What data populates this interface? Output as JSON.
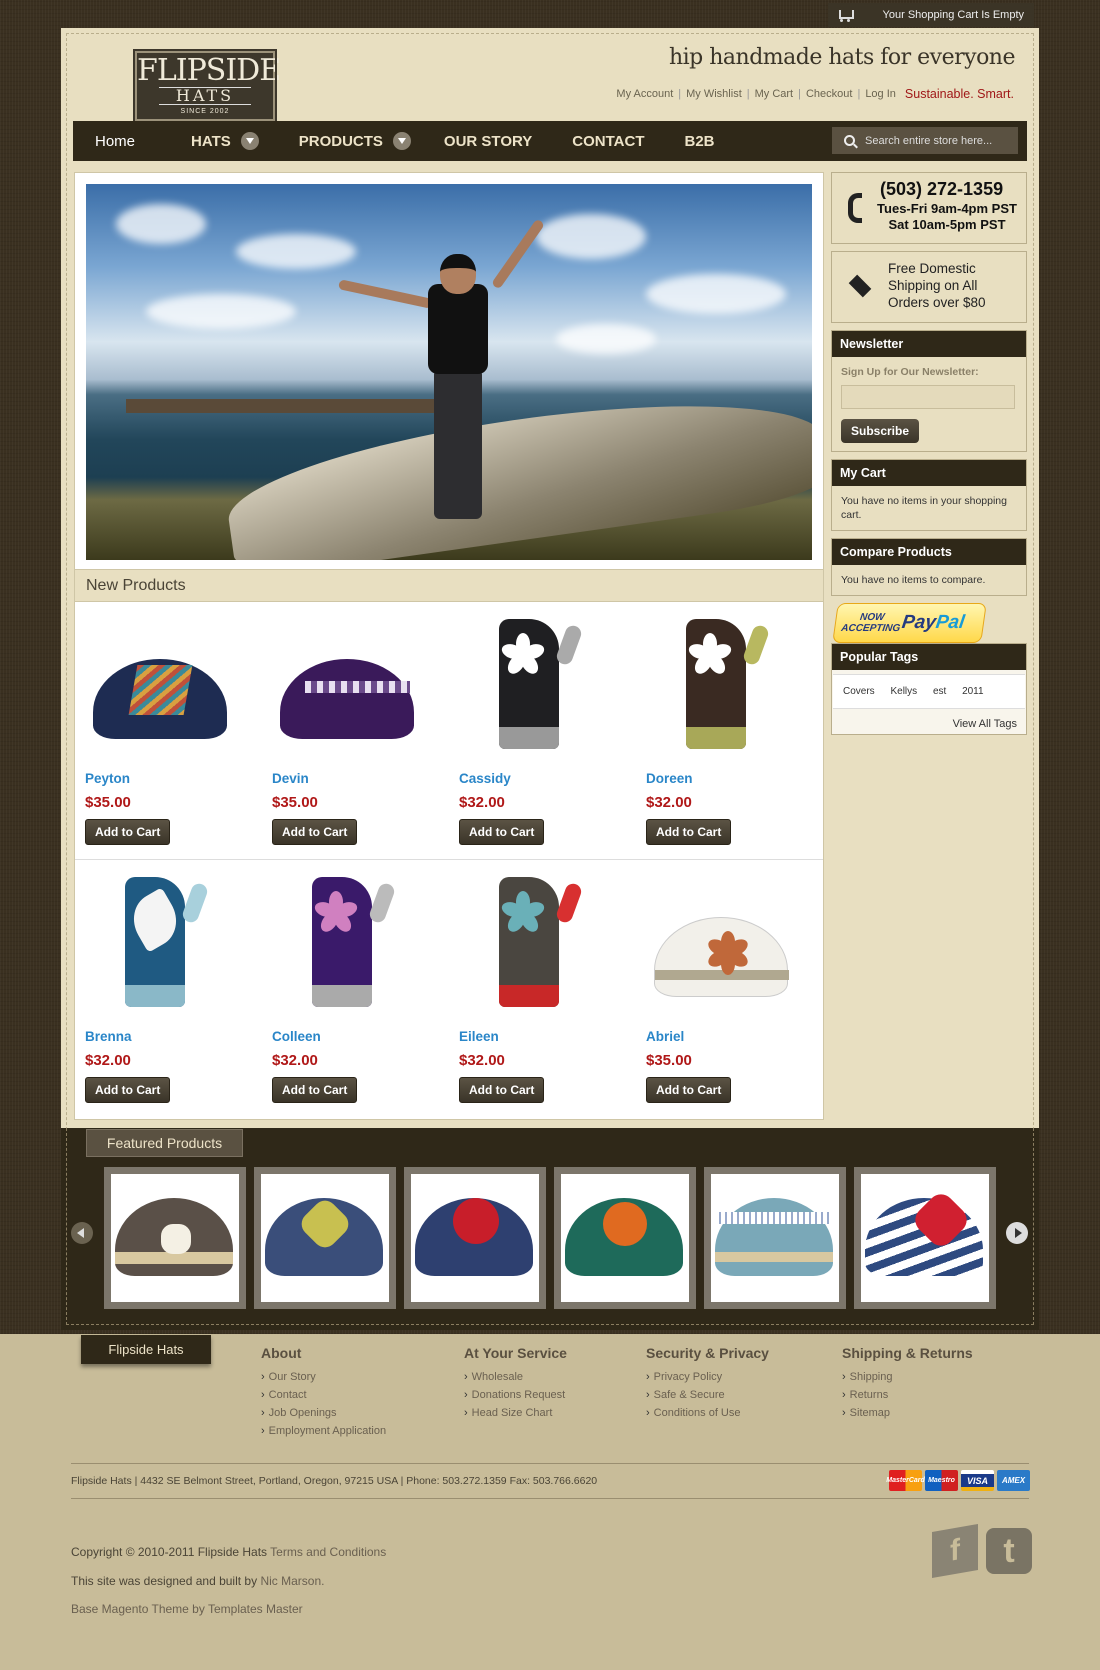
{
  "topbar": {
    "cart_status": "Your Shopping Cart Is Empty"
  },
  "logo": {
    "line1": "FLIPSIDE",
    "line2": "HATS",
    "line3": "SINCE 2002",
    "badge": "F"
  },
  "header": {
    "tagline": "hip handmade hats for everyone",
    "links": [
      "My Account",
      "My Wishlist",
      "My Cart",
      "Checkout",
      "Log In"
    ],
    "slogan": "Sustainable. Smart."
  },
  "nav": {
    "items": [
      "Home",
      "HATS",
      "PRODUCTS",
      "OUR STORY",
      "CONTACT",
      "B2B"
    ],
    "search_placeholder": "Search entire store here..."
  },
  "new_products": {
    "heading": "New Products",
    "add_label": "Add to Cart",
    "items": [
      {
        "name": "Peyton",
        "price": "$35.00"
      },
      {
        "name": "Devin",
        "price": "$35.00"
      },
      {
        "name": "Cassidy",
        "price": "$32.00"
      },
      {
        "name": "Doreen",
        "price": "$32.00"
      },
      {
        "name": "Brenna",
        "price": "$32.00"
      },
      {
        "name": "Colleen",
        "price": "$32.00"
      },
      {
        "name": "Eileen",
        "price": "$32.00"
      },
      {
        "name": "Abriel",
        "price": "$35.00"
      }
    ]
  },
  "sidebar": {
    "phone": {
      "number": "(503) 272-1359",
      "hours1": "Tues-Fri 9am-4pm PST",
      "hours2": "Sat 10am-5pm PST"
    },
    "shipping": {
      "l1": "Free Domestic",
      "l2": "Shipping on All",
      "l3": "Orders over $80"
    },
    "newsletter": {
      "title": "Newsletter",
      "label": "Sign Up for Our Newsletter:",
      "button": "Subscribe"
    },
    "cart": {
      "title": "My Cart",
      "text": "You have no items in your shopping cart."
    },
    "compare": {
      "title": "Compare Products",
      "text": "You have no items to compare."
    },
    "paypal": {
      "l1": "NOW",
      "l2": "ACCEPTING",
      "brand_a": "Pay",
      "brand_b": "Pal",
      "tm": "™"
    },
    "tags": {
      "title": "Popular Tags",
      "items": [
        "Covers",
        "Kellys",
        "est",
        "2011"
      ],
      "view_all": "View All Tags"
    }
  },
  "featured": {
    "heading": "Featured Products"
  },
  "footer": {
    "tab": "Flipside Hats",
    "columns": [
      {
        "title": "About",
        "links": [
          "Our Story",
          "Contact",
          "Job Openings",
          "Employment Application"
        ]
      },
      {
        "title": "At Your Service",
        "links": [
          "Wholesale",
          "Donations Request",
          "Head Size Chart"
        ]
      },
      {
        "title": "Security & Privacy",
        "links": [
          "Privacy Policy",
          "Safe & Secure",
          "Conditions of Use"
        ]
      },
      {
        "title": "Shipping & Returns",
        "links": [
          "Shipping",
          "Returns",
          "Sitemap"
        ]
      }
    ],
    "address": "Flipside Hats | 4432 SE Belmont Street, Portland, Oregon, 97215 USA | Phone: 503.272.1359 Fax: 503.766.6620",
    "cards": [
      "MasterCard",
      "Maestro",
      "VISA",
      "AMEX"
    ],
    "copyright": "Copyright © 2010-2011 Flipside Hats ",
    "terms": "Terms and Conditions",
    "designed": "This site was designed and built by ",
    "designer": "Nic Marson.",
    "theme": "Base Magento Theme by Templates Master",
    "social": [
      "f",
      "t"
    ]
  },
  "colors": {
    "dark": "#2f2818",
    "cream": "#e8dfc1",
    "price": "#b01818",
    "link": "#2a86c8",
    "footer": "#c8bc99"
  }
}
